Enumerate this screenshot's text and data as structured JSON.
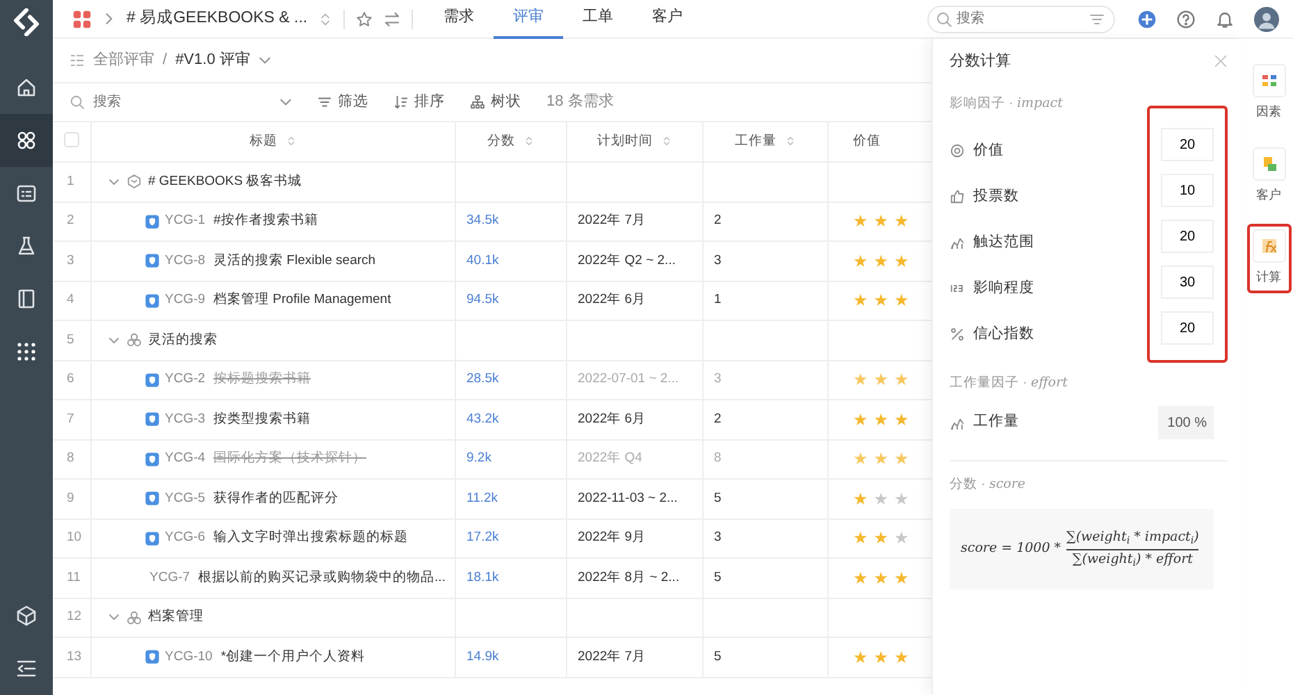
{
  "sidebar": {
    "items": [
      {
        "selected": false
      },
      {
        "selected": true
      },
      {
        "selected": false
      },
      {
        "selected": false
      },
      {
        "selected": false
      },
      {
        "selected": false
      }
    ]
  },
  "top_bar": {
    "project": "# 易成GEEKBOOKS & ...",
    "tabs": [
      {
        "label": "需求",
        "selected": false
      },
      {
        "label": "评审",
        "selected": true
      },
      {
        "label": "工单",
        "selected": false
      },
      {
        "label": "客户",
        "selected": false
      }
    ],
    "search": {
      "placeholder": "搜索"
    }
  },
  "breadcrumb": {
    "root": "全部评审",
    "separator": "/",
    "current": "#V1.0 评审"
  },
  "toolbar": {
    "search_placeholder": "搜索",
    "filter": "筛选",
    "sort": "排序",
    "tree": "树状",
    "count": "18 条需求"
  },
  "table": {
    "select_all": {
      "checked": false
    },
    "columns": [
      "标题",
      "分数",
      "计划时间",
      "工作量",
      "价值"
    ],
    "rows": [
      {
        "kind": "product",
        "number": "1",
        "title": "# GEEKBOOKS 极客书城"
      },
      {
        "kind": "item",
        "number": "2",
        "key": "YCG-1",
        "title": "#按作者搜索书籍",
        "score": "34.5k",
        "plan": "2022年 7月",
        "effort": "2",
        "stars": 3,
        "done": false
      },
      {
        "kind": "item",
        "number": "3",
        "key": "YCG-8",
        "title": "灵活的搜索 Flexible search",
        "score": "40.1k",
        "plan": "2022年 Q2 ~ 2...",
        "effort": "3",
        "stars": 3,
        "done": false
      },
      {
        "kind": "item",
        "number": "4",
        "key": "YCG-9",
        "title": "档案管理 Profile Management",
        "score": "94.5k",
        "plan": "2022年 6月",
        "effort": "1",
        "stars": 3,
        "done": false
      },
      {
        "kind": "module",
        "number": "5",
        "title": "灵活的搜索"
      },
      {
        "kind": "item",
        "number": "6",
        "key": "YCG-2",
        "title": "按标题搜索书籍",
        "score": "28.5k",
        "plan": "2022-07-01 ~ 2...",
        "effort": "3",
        "stars": 3,
        "done": true
      },
      {
        "kind": "item",
        "number": "7",
        "key": "YCG-3",
        "title": "按类型搜索书籍",
        "score": "43.2k",
        "plan": "2022年 6月",
        "effort": "2",
        "stars": 3,
        "done": false
      },
      {
        "kind": "item",
        "number": "8",
        "key": "YCG-4",
        "title": "国际化方案（技术探针）",
        "score": "9.2k",
        "plan": "2022年 Q4",
        "effort": "8",
        "stars": 3,
        "done": true
      },
      {
        "kind": "item",
        "number": "9",
        "key": "YCG-5",
        "title": "获得作者的匹配评分",
        "score": "11.2k",
        "plan": "2022-11-03 ~ 2...",
        "effort": "5",
        "stars": 1,
        "done": false
      },
      {
        "kind": "item",
        "number": "10",
        "key": "YCG-6",
        "title": "输入文字时弹出搜索标题的标题",
        "score": "17.2k",
        "plan": "2022年 9月",
        "effort": "3",
        "stars": 2,
        "done": false
      },
      {
        "kind": "item",
        "number": "11",
        "key": "YCG-7",
        "title": "根据以前的购买记录或购物袋中的物品...",
        "score": "18.1k",
        "plan": "2022年 8月 ~ 2...",
        "effort": "5",
        "stars": 3,
        "done": false
      },
      {
        "kind": "module",
        "number": "12",
        "title": "档案管理"
      },
      {
        "kind": "item",
        "number": "13",
        "key": "YCG-10",
        "title": "*创建一个用户个人资料",
        "score": "14.9k",
        "plan": "2022年 7月",
        "effort": "5",
        "stars": 3,
        "done": false
      }
    ]
  },
  "panel": {
    "title": "分数计算",
    "impact_heading": "影响因子 ·",
    "impact_var": "impact",
    "impact_highlighted": true,
    "impact_fields": [
      {
        "label": "价值",
        "value": "20"
      },
      {
        "label": "投票数",
        "value": "10"
      },
      {
        "label": "触达范围",
        "value": "20"
      },
      {
        "label": "影响程度",
        "value": "30"
      },
      {
        "label": "信心指数",
        "value": "20"
      }
    ],
    "effort_heading": "工作量因子 ·",
    "effort_var": "effort",
    "effort_fields": [
      {
        "label": "工作量",
        "value": "100 %",
        "disabled": true
      }
    ],
    "score_heading": "分数 ·",
    "score_var": "score",
    "formula": {
      "lhs": "score = 1000 *",
      "numerator": "∑(weight$_{i}$ * impact$_{i}$)",
      "denominator": "∑(weight$_{i}$) * effort"
    }
  },
  "rail": {
    "items": [
      {
        "label": "因素",
        "selected": false
      },
      {
        "label": "客户",
        "selected": false
      },
      {
        "label": "计算",
        "selected": true
      }
    ]
  }
}
